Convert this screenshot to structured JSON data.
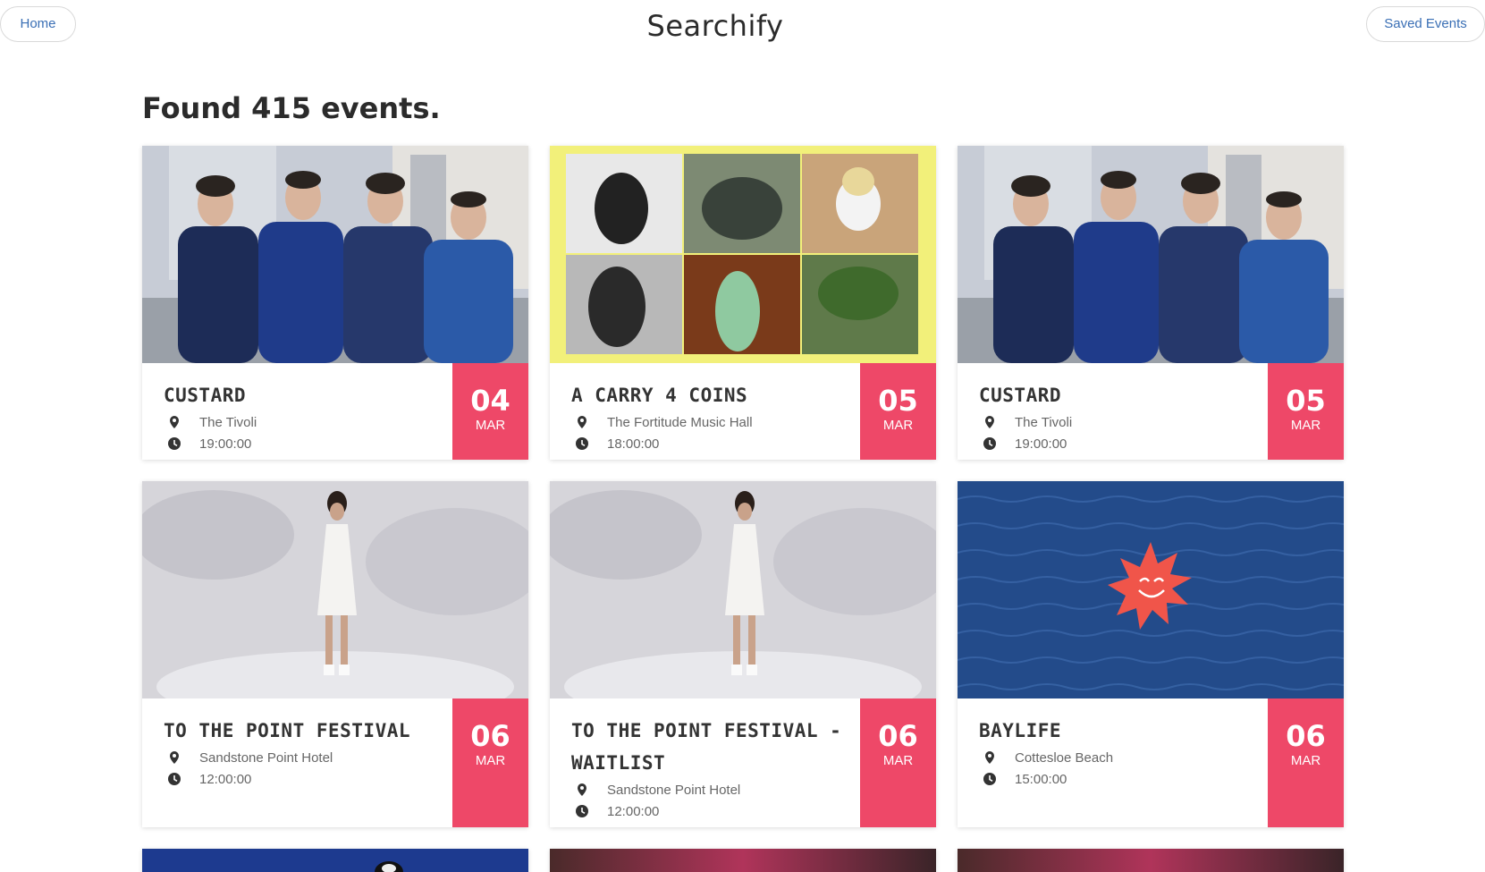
{
  "header": {
    "home_label": "Home",
    "brand": "Searchify",
    "saved_label": "Saved Events"
  },
  "results": {
    "title": "Found 415 events."
  },
  "colors": {
    "accent": "#ee4868",
    "link": "#3a6fb5"
  },
  "icons": {
    "venue": "map-marker-icon",
    "time": "clock-icon"
  },
  "events": [
    {
      "title": "CUSTARD",
      "venue": "The Tivoli",
      "time": "19:00:00",
      "day": "04",
      "month": "MAR",
      "image": "band-photo"
    },
    {
      "title": "A CARRY 4 COINS",
      "venue": "The Fortitude Music Hall",
      "time": "18:00:00",
      "day": "05",
      "month": "MAR",
      "image": "artist-collage"
    },
    {
      "title": "CUSTARD",
      "venue": "The Tivoli",
      "time": "19:00:00",
      "day": "05",
      "month": "MAR",
      "image": "band-photo"
    },
    {
      "title": "TO THE POINT FESTIVAL",
      "venue": "Sandstone Point Hotel",
      "time": "12:00:00",
      "day": "06",
      "month": "MAR",
      "image": "artist-portrait"
    },
    {
      "title": "TO THE POINT FESTIVAL - WAITLIST",
      "venue": "Sandstone Point Hotel",
      "time": "12:00:00",
      "day": "06",
      "month": "MAR",
      "image": "artist-portrait"
    },
    {
      "title": "BAYLIFE",
      "venue": "Cottesloe Beach",
      "time": "15:00:00",
      "day": "06",
      "month": "MAR",
      "image": "sun-logo-on-water"
    }
  ]
}
